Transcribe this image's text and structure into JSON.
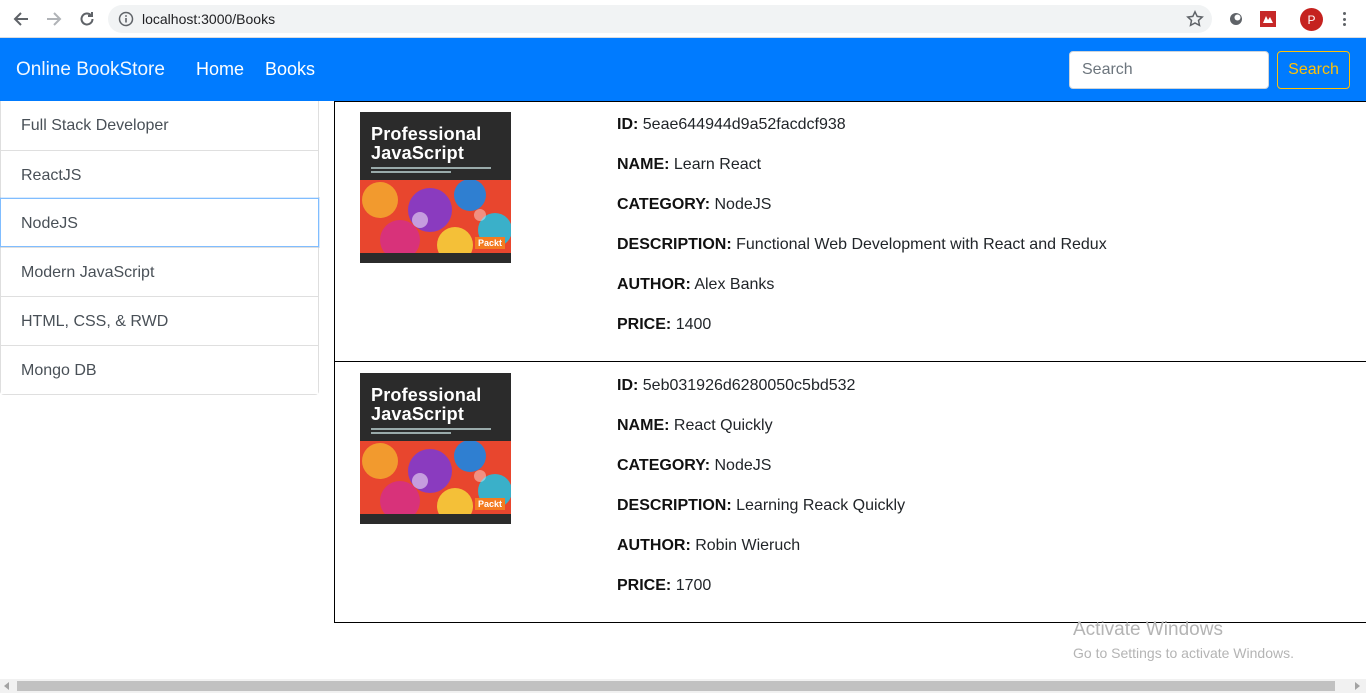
{
  "browser": {
    "url": "localhost:3000/Books",
    "profile_initial": "P"
  },
  "navbar": {
    "brand": "Online BookStore",
    "links": [
      "Home",
      "Books"
    ],
    "search_placeholder": "Search",
    "search_button": "Search",
    "color": "#007bff",
    "button_color": "#ffc107"
  },
  "sidebar": {
    "items": [
      {
        "label": "Full Stack Developer"
      },
      {
        "label": "ReactJS"
      },
      {
        "label": "NodeJS",
        "active": true
      },
      {
        "label": "Modern JavaScript"
      },
      {
        "label": "HTML, CSS, & RWD"
      },
      {
        "label": "Mongo DB"
      }
    ]
  },
  "labels": {
    "id": "ID:",
    "name": "NAME:",
    "category": "CATEGORY:",
    "description": "DESCRIPTION:",
    "author": "AUTHOR:",
    "price": "PRICE:"
  },
  "books": [
    {
      "cover_title": "Professional JavaScript",
      "cover_publisher": "Packt",
      "id": "5eae644944d9a52facdcf938",
      "name": "Learn React",
      "category": "NodeJS",
      "description": "Functional Web Development with React and Redux",
      "author": "Alex Banks",
      "price": "1400"
    },
    {
      "cover_title": "Professional JavaScript",
      "cover_publisher": "Packt",
      "id": "5eb031926d6280050c5bd532",
      "name": "React Quickly",
      "category": "NodeJS",
      "description": "Learning Reack Quickly",
      "author": "Robin Wieruch",
      "price": "1700"
    }
  ],
  "watermark": {
    "line1": "Activate Windows",
    "line2": "Go to Settings to activate Windows."
  }
}
